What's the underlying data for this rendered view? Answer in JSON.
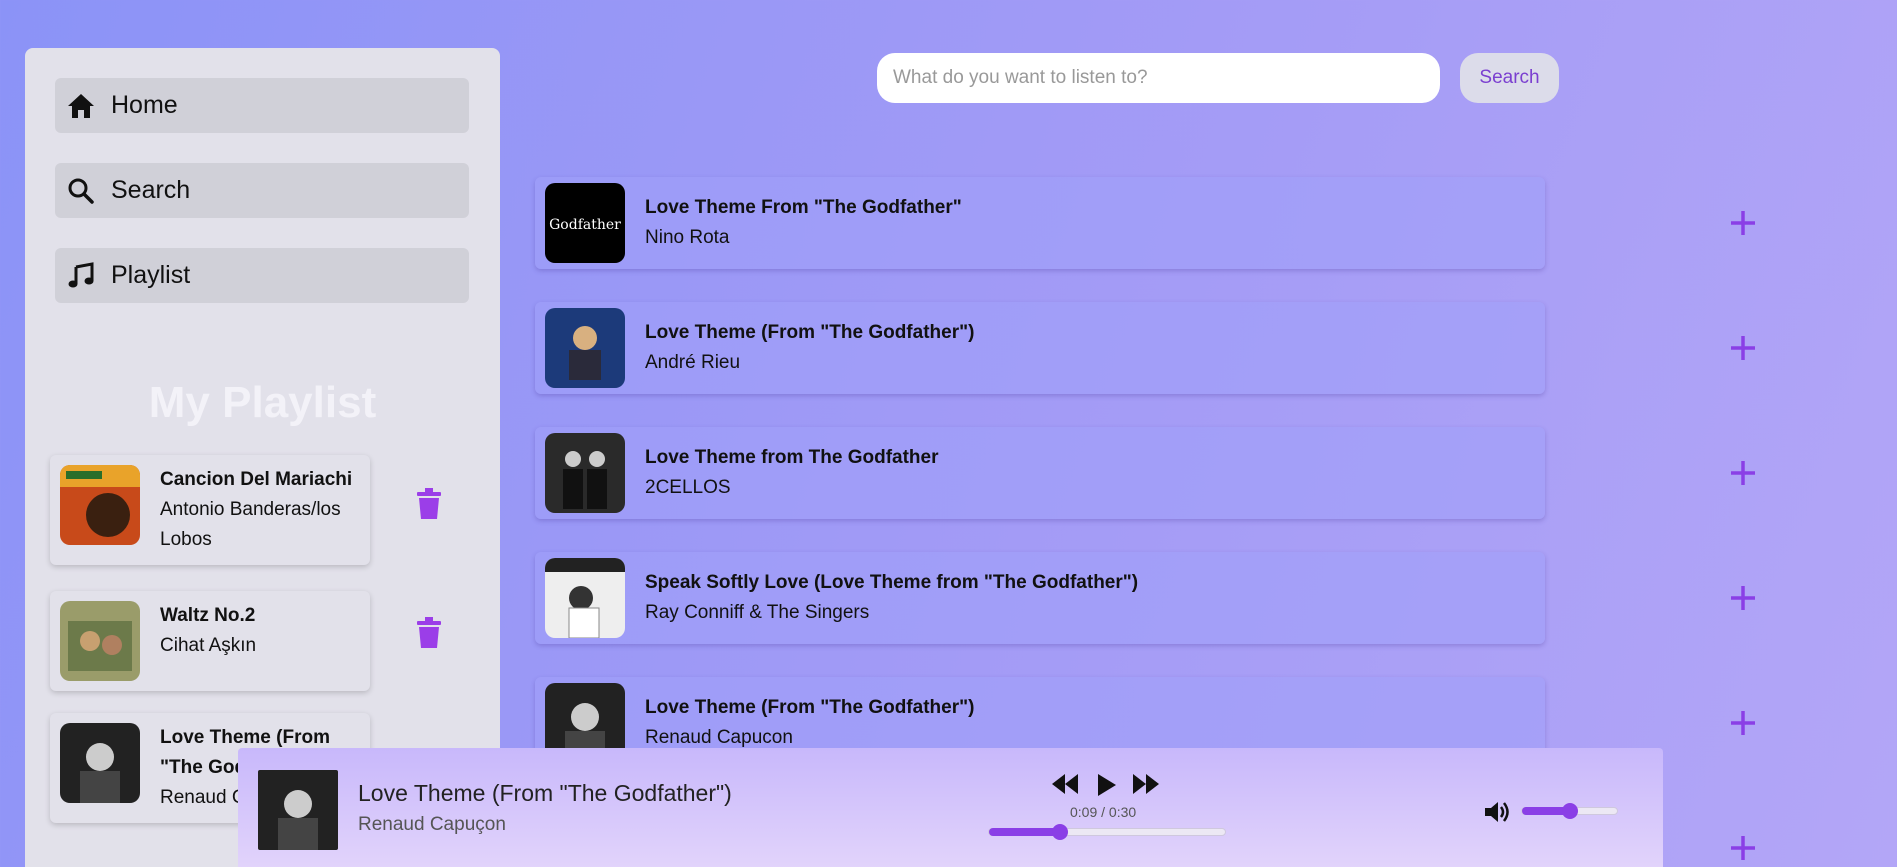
{
  "sidebar": {
    "nav": [
      {
        "label": "Home",
        "icon": "home-icon"
      },
      {
        "label": "Search",
        "icon": "search-icon"
      },
      {
        "label": "Playlist",
        "icon": "music-note-icon"
      }
    ],
    "playlist_title": "My Playlist",
    "playlist": [
      {
        "title": "Cancion Del Mariachi",
        "artist": "Antonio Banderas/los Lobos"
      },
      {
        "title": "Waltz No.2",
        "artist": "Cihat Aşkın"
      },
      {
        "title": "Love Theme (From \"The Godfather\")",
        "artist": "Renaud Capuçon"
      }
    ]
  },
  "search": {
    "placeholder": "What do you want to listen to?",
    "button_label": "Search"
  },
  "results": [
    {
      "title": "Love Theme From \"The Godfather\"",
      "artist": "Nino Rota"
    },
    {
      "title": "Love Theme (From \"The Godfather\")",
      "artist": "André Rieu"
    },
    {
      "title": "Love Theme from The Godfather",
      "artist": "2CELLOS"
    },
    {
      "title": "Speak Softly Love (Love Theme from \"The Godfather\")",
      "artist": "Ray Conniff & The Singers"
    },
    {
      "title": "Love Theme (From \"The Godfather\")",
      "artist": "Renaud Capucon"
    }
  ],
  "player": {
    "title": "Love Theme (From \"The Godfather\")",
    "artist": "Renaud Capuçon",
    "time": "0:09 / 0:30",
    "progress_fraction": 0.3,
    "volume_fraction": 0.5
  },
  "colors": {
    "accent": "#8a3fe6",
    "background_start": "#8b93f7",
    "background_end": "#b3a6f7"
  }
}
